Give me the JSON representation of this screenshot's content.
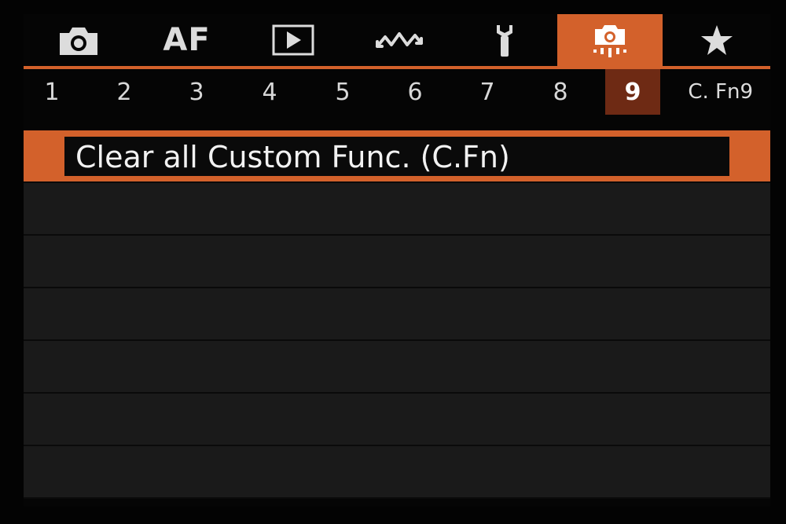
{
  "tabs": [
    {
      "id": "shooting",
      "icon": "camera-icon",
      "label": ""
    },
    {
      "id": "af",
      "icon": "",
      "label": "AF"
    },
    {
      "id": "playback",
      "icon": "playback-icon",
      "label": ""
    },
    {
      "id": "wireless",
      "icon": "wireless-icon",
      "label": ""
    },
    {
      "id": "setup",
      "icon": "wrench-icon",
      "label": ""
    },
    {
      "id": "custom-functions",
      "icon": "custom-functions-camera-icon",
      "label": "",
      "active": true
    },
    {
      "id": "my-menu",
      "icon": "star-icon",
      "label": ""
    }
  ],
  "subtabs": [
    "1",
    "2",
    "3",
    "4",
    "5",
    "6",
    "7",
    "8",
    "9"
  ],
  "active_subtab": "9",
  "section_label": "C. Fn9",
  "menu": {
    "items": [
      {
        "label": "Clear all Custom Func. (C.Fn)",
        "selected": true
      },
      {
        "label": ""
      },
      {
        "label": ""
      },
      {
        "label": ""
      },
      {
        "label": ""
      },
      {
        "label": ""
      }
    ]
  },
  "colors": {
    "accent": "#d3612b",
    "active_subtab_bg": "#6e2a14",
    "row_bg": "#1a1a1a",
    "background": "#050505"
  }
}
